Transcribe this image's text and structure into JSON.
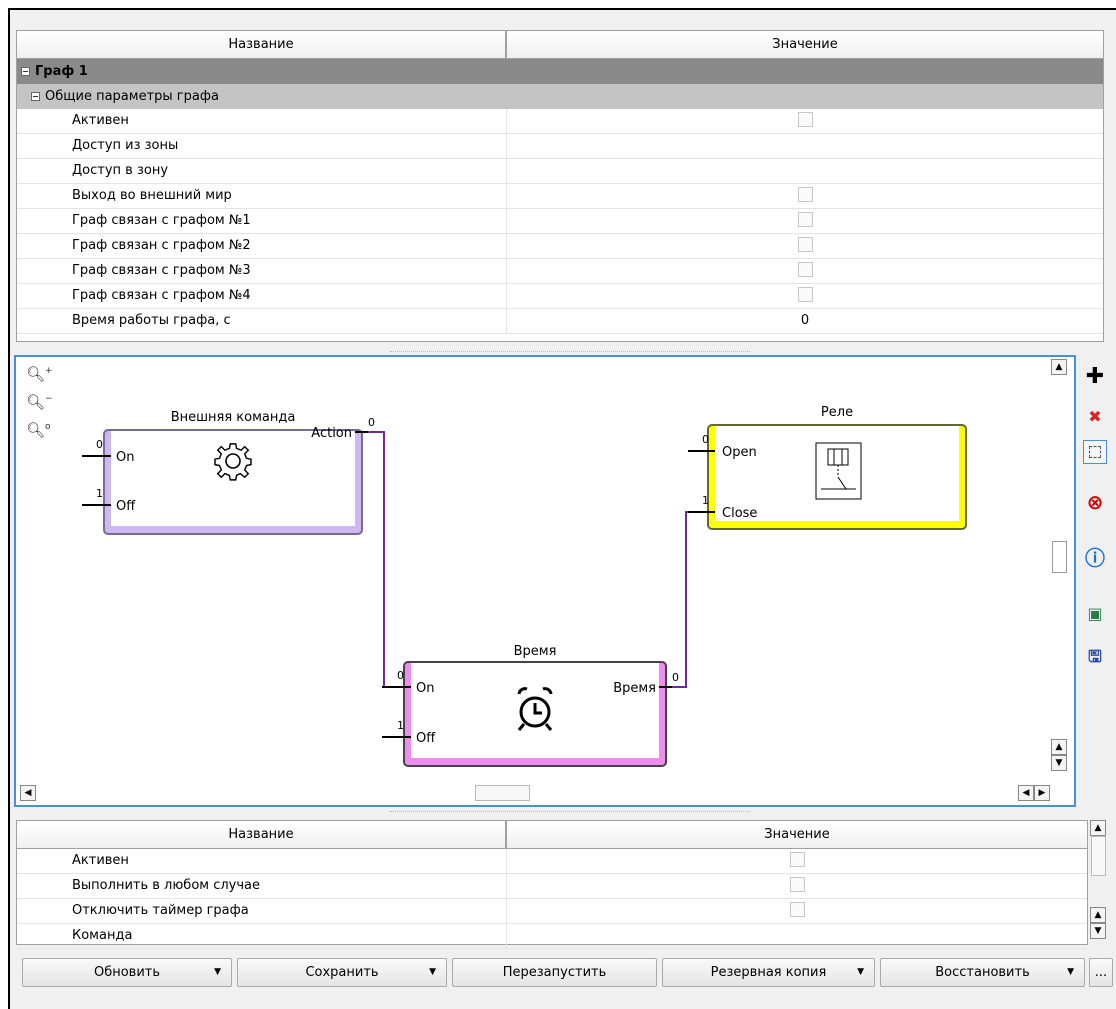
{
  "top_table": {
    "col_name": "Название",
    "col_value": "Значение",
    "group": "Граф 1",
    "subgroup": "Общие параметры графа",
    "rows": [
      {
        "name": "Активен",
        "value": "",
        "checkbox": true
      },
      {
        "name": "Доступ из зоны",
        "value": "",
        "checkbox": false
      },
      {
        "name": "Доступ в зону",
        "value": "",
        "checkbox": false
      },
      {
        "name": "Выход во внешний мир",
        "value": "",
        "checkbox": true
      },
      {
        "name": "Граф связан с графом №1",
        "value": "",
        "checkbox": true
      },
      {
        "name": "Граф связан с графом №2",
        "value": "",
        "checkbox": true
      },
      {
        "name": "Граф связан с графом №3",
        "value": "",
        "checkbox": true
      },
      {
        "name": "Граф связан с графом №4",
        "value": "",
        "checkbox": true
      },
      {
        "name": "Время работы графа, с",
        "value": "0",
        "checkbox": false
      }
    ]
  },
  "graph": {
    "nodes": [
      {
        "title": "Внешняя команда",
        "in": [
          {
            "label": "On",
            "idx": "0"
          },
          {
            "label": "Off",
            "idx": "1"
          }
        ],
        "out": [
          {
            "label": "Action",
            "idx": "0"
          }
        ],
        "icon": "gear-icon",
        "color": "#cdb8f0",
        "border": "#7a6a9a"
      },
      {
        "title": "Реле",
        "in": [
          {
            "label": "Open",
            "idx": "0"
          },
          {
            "label": "Close",
            "idx": "1"
          }
        ],
        "out": [],
        "icon": "relay-icon",
        "color": "#ffff00",
        "border": "#666633"
      },
      {
        "title": "Время",
        "in": [
          {
            "label": "On",
            "idx": "0"
          },
          {
            "label": "Off",
            "idx": "1"
          }
        ],
        "out": [
          {
            "label": "Время",
            "idx": "0"
          }
        ],
        "icon": "alarm-clock-icon",
        "color": "#f08cf0",
        "border": "#444"
      }
    ],
    "wire_color": "#6a2aa8"
  },
  "bottom_table": {
    "col_name": "Название",
    "col_value": "Значение",
    "rows": [
      {
        "name": "Активен",
        "checkbox": true
      },
      {
        "name": "Выполнить в любом случае",
        "checkbox": true
      },
      {
        "name": "Отключить таймер графа",
        "checkbox": true
      },
      {
        "name": "Команда",
        "checkbox": false
      }
    ]
  },
  "buttons": {
    "refresh": "Обновить",
    "save": "Сохранить",
    "restart": "Перезапустить",
    "backup": "Резервная копия",
    "restore": "Восстановить",
    "more": "..."
  }
}
